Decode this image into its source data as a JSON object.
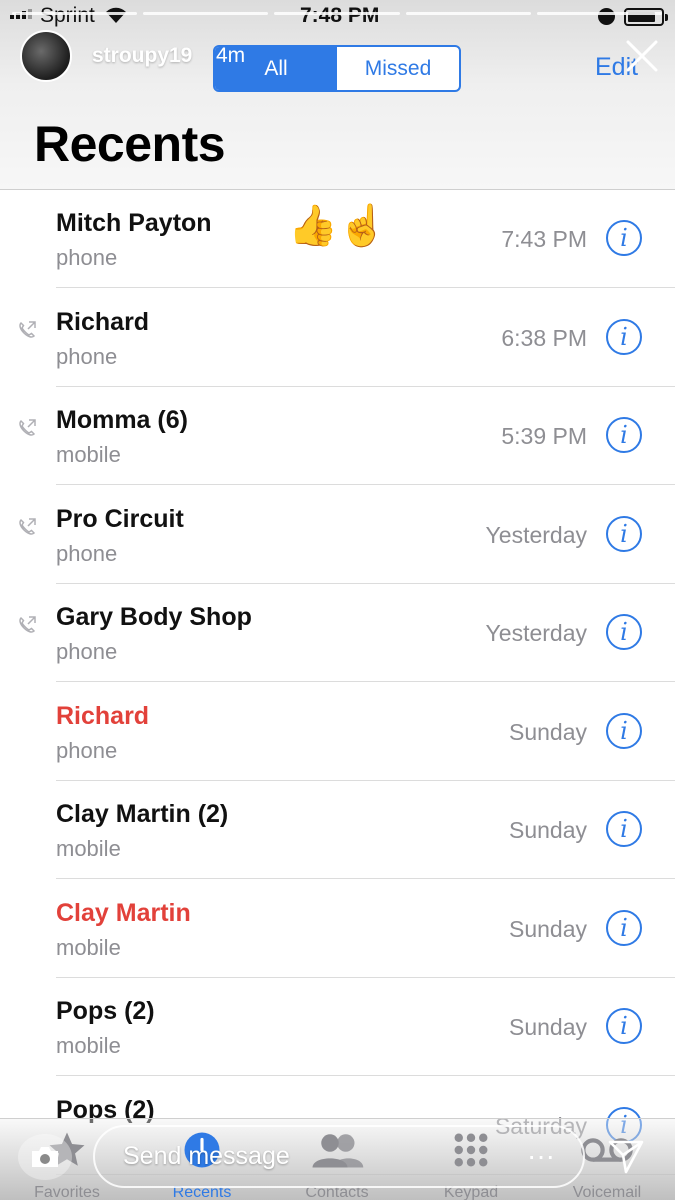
{
  "status_bar": {
    "carrier": "Sprint",
    "time": "7:48 PM",
    "battery_level": 0.85
  },
  "story": {
    "username": "stroupy19",
    "age": "4m"
  },
  "header": {
    "segment_all": "All",
    "segment_missed": "Missed",
    "edit_label": "Edit",
    "title": "Recents"
  },
  "sticker": {
    "emoji": "👍☝️"
  },
  "calls": [
    {
      "name": "Mitch Payton",
      "type": "phone",
      "time": "7:43 PM",
      "missed": false,
      "outgoing": false
    },
    {
      "name": "Richard",
      "type": "phone",
      "time": "6:38 PM",
      "missed": false,
      "outgoing": true
    },
    {
      "name": "Momma (6)",
      "type": "mobile",
      "time": "5:39 PM",
      "missed": false,
      "outgoing": true
    },
    {
      "name": "Pro Circuit",
      "type": "phone",
      "time": "Yesterday",
      "missed": false,
      "outgoing": true
    },
    {
      "name": "Gary Body Shop",
      "type": "phone",
      "time": "Yesterday",
      "missed": false,
      "outgoing": true
    },
    {
      "name": "Richard",
      "type": "phone",
      "time": "Sunday",
      "missed": true,
      "outgoing": false
    },
    {
      "name": "Clay Martin (2)",
      "type": "mobile",
      "time": "Sunday",
      "missed": false,
      "outgoing": false
    },
    {
      "name": "Clay Martin",
      "type": "mobile",
      "time": "Sunday",
      "missed": true,
      "outgoing": false
    },
    {
      "name": "Pops (2)",
      "type": "mobile",
      "time": "Sunday",
      "missed": false,
      "outgoing": false
    },
    {
      "name": "Pops (2)",
      "type": "",
      "time": "Saturday",
      "missed": false,
      "outgoing": false
    }
  ],
  "tab_bar": {
    "favorites": "Favorites",
    "recents": "Recents",
    "contacts": "Contacts",
    "keypad": "Keypad",
    "voicemail": "Voicemail",
    "active": "recents"
  },
  "composer": {
    "placeholder": "Send message",
    "more": "···"
  },
  "colors": {
    "accent": "#2f7ae5",
    "missed": "#e2413a",
    "secondary_text": "#8e8e93"
  }
}
